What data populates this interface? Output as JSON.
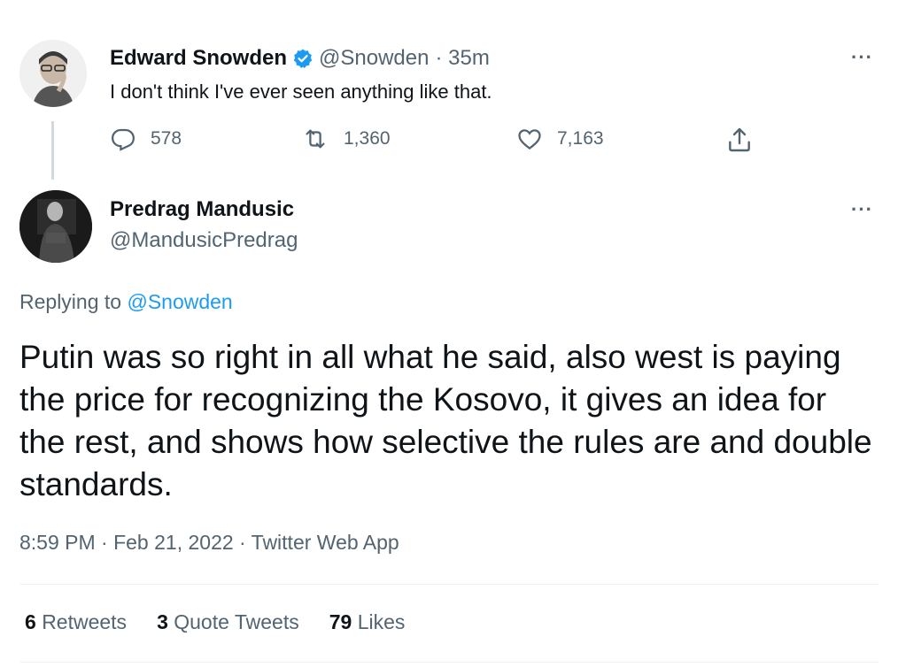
{
  "parent_tweet": {
    "name": "Edward Snowden",
    "handle": "@Snowden",
    "time": "· 35m",
    "text": "I don't think I've ever seen anything like that.",
    "replies": "578",
    "retweets": "1,360",
    "likes": "7,163",
    "more": "···"
  },
  "main_tweet": {
    "name": "Predrag Mandusic",
    "handle": "@MandusicPredrag",
    "more": "···",
    "replying_prefix": "Replying to",
    "replying_to": "@Snowden",
    "text": "Putin was so right in all what he said, also west is paying the price for recognizing the Kosovo, it gives an idea for the rest, and shows how selective the rules are and double standards.",
    "timestamp": "8:59 PM · Feb 21, 2022 · Twitter Web App",
    "stats": {
      "retweets_count": "6",
      "retweets_label": "Retweets",
      "quotes_count": "3",
      "quotes_label": "Quote Tweets",
      "likes_count": "79",
      "likes_label": "Likes"
    }
  },
  "colors": {
    "verified": "#1d9bf0",
    "link": "#1d9bf0",
    "secondary_text": "#536471"
  }
}
